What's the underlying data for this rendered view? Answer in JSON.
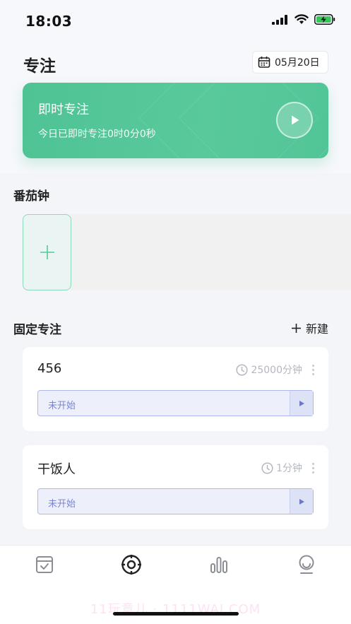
{
  "status_bar": {
    "time": "18:03"
  },
  "header": {
    "title": "专注",
    "date": "05月20日"
  },
  "instant_focus": {
    "title": "即时专注",
    "subtitle": "今日已即时专注0时0分0秒"
  },
  "pomodoro": {
    "title": "番茄钟"
  },
  "fixed_focus": {
    "title": "固定专注",
    "new_label": "新建",
    "items": [
      {
        "name": "456",
        "duration": "25000分钟",
        "status": "未开始"
      },
      {
        "name": "干饭人",
        "duration": "1分钟",
        "status": "未开始"
      }
    ]
  },
  "watermark": "11玩意儿 · 1111WAI.COM",
  "colors": {
    "accent_green": "#52c597",
    "status_blue": "#7b86cf"
  }
}
